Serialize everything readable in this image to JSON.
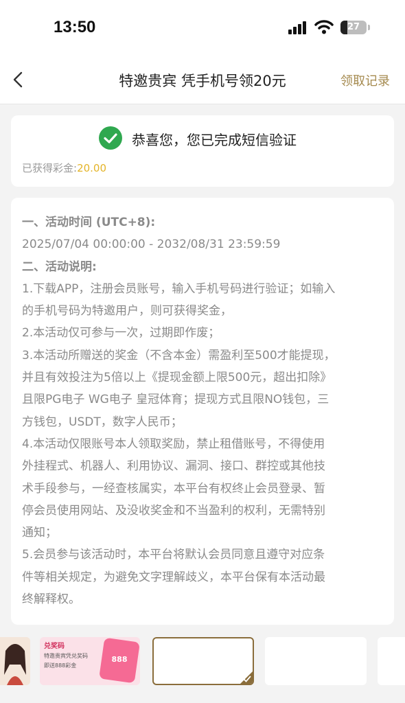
{
  "status_bar": {
    "time": "13:50",
    "battery_level": "27",
    "battery_fraction": 0.27
  },
  "nav": {
    "title": "特邀贵宾 凭手机号领20元",
    "action": "领取记录"
  },
  "success": {
    "message": "恭喜您，您已完成短信验证",
    "bonus_label": "已获得彩金:",
    "bonus_value": "20.00"
  },
  "rules": {
    "lines": [
      "一、活动时间 (UTC+8):",
      "2025/07/04 00:00:00 - 2032/08/31 23:59:59",
      "二、活动说明:",
      "1.下载APP，注册会员账号，输入手机号码进行验证；如输入",
      "的手机号码为特邀用户，则可获得奖金，",
      "2.本活动仅可参与一次，过期即作废；",
      "3.本活动所赠送的奖金（不含本金）需盈利至500才能提现，",
      "并且有效投注为5倍以上《提现金额上限500元，超出扣除》",
      "且限PG电子 WG电子 皇冠体育；提现方式且限NO钱包，三",
      "方钱包，USDT，数字人民币；",
      "4.本活动仅限账号本人领取奖励，禁止租借账号，不得使用",
      "外挂程式、机器人、利用协议、漏洞、接口、群控或其他技",
      "术手段参与，一经查核属实，本平台有权终止会员登录、暂",
      "停会员使用网站、及没收奖金和不当盈利的权利，无需特别",
      "通知；",
      "5.会员参与该活动时，本平台将默认会员同意且遵守对应条",
      "件等相关规定，为避免文字理解歧义，本平台保有本活动最",
      "终解释权。"
    ]
  },
  "thumbs": {
    "banner_title": "兑奖码",
    "banner_line1": "特邀贵宾凭兑奖码",
    "banner_line2": "即送888彩金",
    "banner_badge": "888"
  },
  "colors": {
    "accent_gold": "#a58a4f",
    "bonus_yellow": "#e4b428",
    "success_green": "#2fa84f"
  }
}
